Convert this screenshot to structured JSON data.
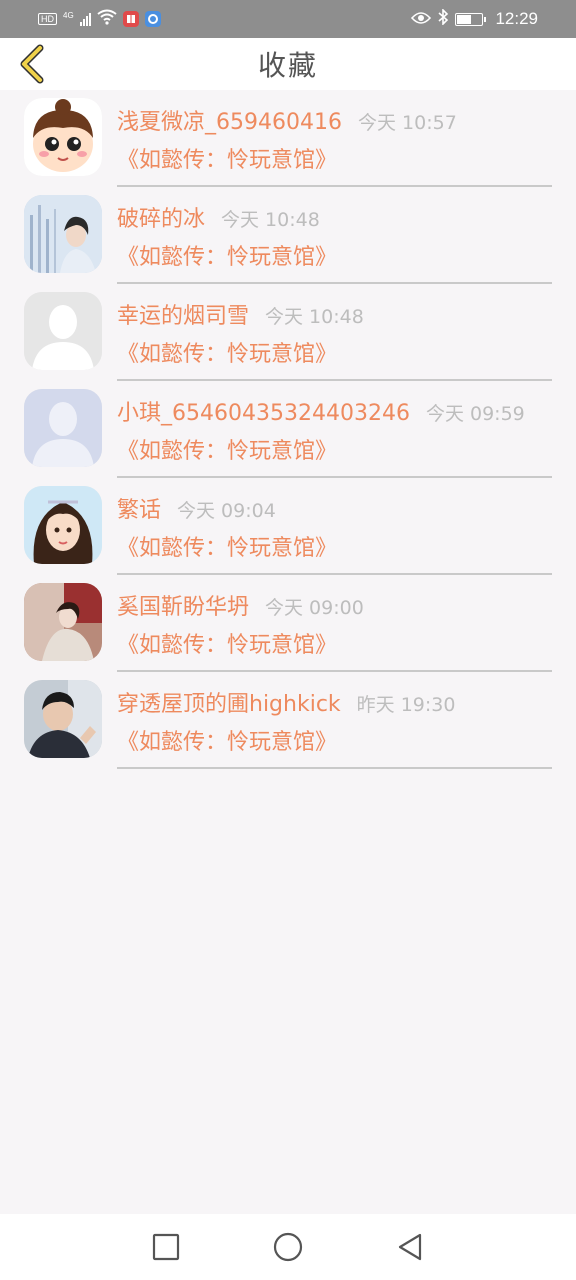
{
  "status_bar": {
    "hd": "HD",
    "network": "4G",
    "time": "12:29"
  },
  "header": {
    "title": "收藏",
    "back_icon": "chevron-left-icon"
  },
  "colors": {
    "accent": "#ee8a5e",
    "timestamp": "#bdbdbd",
    "back_arrow": "#e8c53a"
  },
  "favorites": [
    {
      "user": "浅夏微凉_659460416",
      "time": "今天 10:57",
      "book": "《如懿传：怜玩意馆》",
      "avatar": "cartoon-girl-avatar"
    },
    {
      "user": "破碎的冰",
      "time": "今天 10:48",
      "book": "《如懿传：怜玩意馆》",
      "avatar": "costume-photo-avatar"
    },
    {
      "user": "幸运的烟司雪",
      "time": "今天 10:48",
      "book": "《如懿传：怜玩意馆》",
      "avatar": "default-gray-avatar"
    },
    {
      "user": "小琪_65460435324403246",
      "time": "今天 09:59",
      "book": "《如懿传：怜玩意馆》",
      "avatar": "default-blue-avatar"
    },
    {
      "user": "繁话",
      "time": "今天 09:04",
      "book": "《如懿传：怜玩意馆》",
      "avatar": "illustrated-girl-avatar"
    },
    {
      "user": "奚国靳盼华坍",
      "time": "今天 09:00",
      "book": "《如懿传：怜玩意馆》",
      "avatar": "costume-painting-avatar"
    },
    {
      "user": "穿透屋顶的圃highkick",
      "time": "昨天 19:30",
      "book": "《如懿传：怜玩意馆》",
      "avatar": "man-photo-avatar"
    }
  ],
  "nav_bar": {
    "recent_icon": "square-icon",
    "home_icon": "circle-icon",
    "back_icon": "triangle-back-icon"
  }
}
